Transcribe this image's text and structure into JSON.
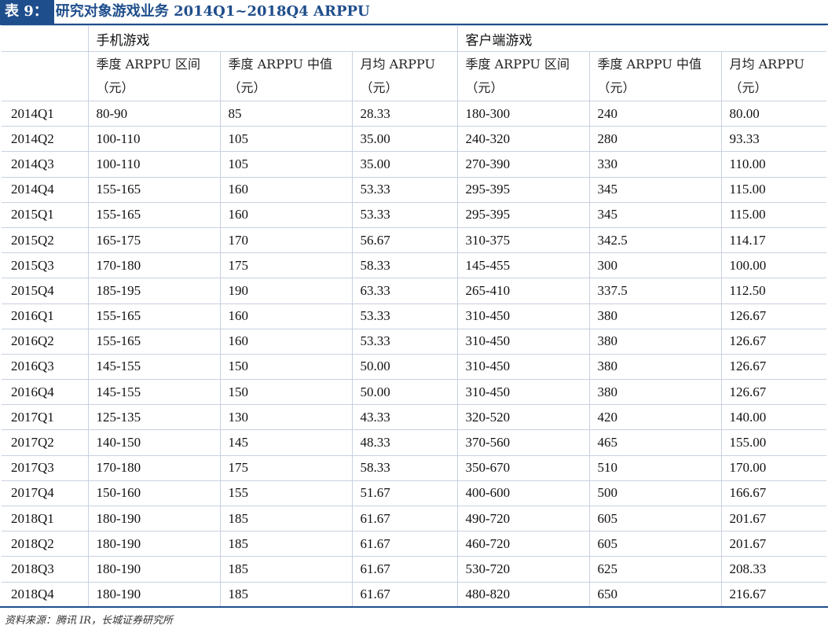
{
  "title": {
    "label": "表 9：",
    "text": "研究对象游戏业务 2014Q1~2018Q4 ARPPU"
  },
  "table": {
    "groups": [
      "手机游戏",
      "客户端游戏"
    ],
    "sub_headers": [
      {
        "label": "季度 ARPPU 区间",
        "unit": "（元）"
      },
      {
        "label": "季度 ARPPU 中值",
        "unit": "（元）"
      },
      {
        "label": "月均 ARPPU",
        "unit": "（元）"
      },
      {
        "label": "季度 ARPPU 区间",
        "unit": "（元）"
      },
      {
        "label": "季度 ARPPU 中值",
        "unit": "（元）"
      },
      {
        "label": "月均 ARPPU",
        "unit": "（元）"
      }
    ],
    "rows": [
      [
        "2014Q1",
        "80-90",
        "85",
        "28.33",
        "180-300",
        "240",
        "80.00"
      ],
      [
        "2014Q2",
        "100-110",
        "105",
        "35.00",
        "240-320",
        "280",
        "93.33"
      ],
      [
        "2014Q3",
        "100-110",
        "105",
        "35.00",
        "270-390",
        "330",
        "110.00"
      ],
      [
        "2014Q4",
        "155-165",
        "160",
        "53.33",
        "295-395",
        "345",
        "115.00"
      ],
      [
        "2015Q1",
        "155-165",
        "160",
        "53.33",
        "295-395",
        "345",
        "115.00"
      ],
      [
        "2015Q2",
        "165-175",
        "170",
        "56.67",
        "310-375",
        "342.5",
        "114.17"
      ],
      [
        "2015Q3",
        "170-180",
        "175",
        "58.33",
        "145-455",
        "300",
        "100.00"
      ],
      [
        "2015Q4",
        "185-195",
        "190",
        "63.33",
        "265-410",
        "337.5",
        "112.50"
      ],
      [
        "2016Q1",
        "155-165",
        "160",
        "53.33",
        "310-450",
        "380",
        "126.67"
      ],
      [
        "2016Q2",
        "155-165",
        "160",
        "53.33",
        "310-450",
        "380",
        "126.67"
      ],
      [
        "2016Q3",
        "145-155",
        "150",
        "50.00",
        "310-450",
        "380",
        "126.67"
      ],
      [
        "2016Q4",
        "145-155",
        "150",
        "50.00",
        "310-450",
        "380",
        "126.67"
      ],
      [
        "2017Q1",
        "125-135",
        "130",
        "43.33",
        "320-520",
        "420",
        "140.00"
      ],
      [
        "2017Q2",
        "140-150",
        "145",
        "48.33",
        "370-560",
        "465",
        "155.00"
      ],
      [
        "2017Q3",
        "170-180",
        "175",
        "58.33",
        "350-670",
        "510",
        "170.00"
      ],
      [
        "2017Q4",
        "150-160",
        "155",
        "51.67",
        "400-600",
        "500",
        "166.67"
      ],
      [
        "2018Q1",
        "180-190",
        "185",
        "61.67",
        "490-720",
        "605",
        "201.67"
      ],
      [
        "2018Q2",
        "180-190",
        "185",
        "61.67",
        "460-720",
        "605",
        "201.67"
      ],
      [
        "2018Q3",
        "180-190",
        "185",
        "61.67",
        "530-720",
        "625",
        "208.33"
      ],
      [
        "2018Q4",
        "180-190",
        "185",
        "61.67",
        "480-820",
        "650",
        "216.67"
      ]
    ]
  },
  "source": "资料来源：腾讯 IR，长城证券研究所",
  "colors": {
    "accent": "#1f4e8c",
    "grid": "#c8d1df"
  }
}
